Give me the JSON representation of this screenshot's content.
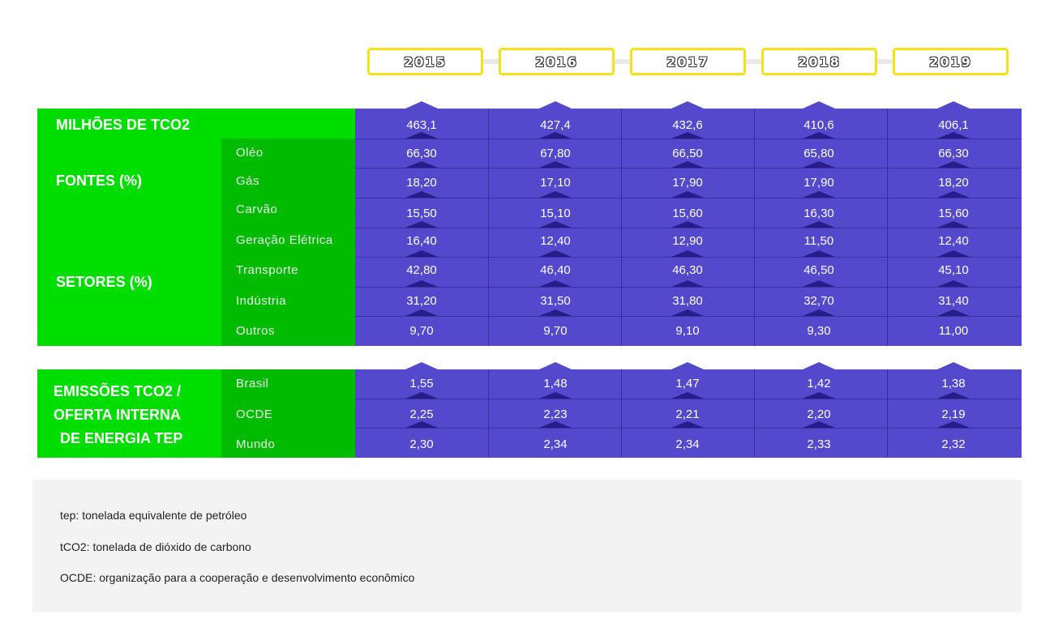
{
  "years": [
    "2015",
    "2016",
    "2017",
    "2018",
    "2019"
  ],
  "colors": {
    "label_green": "#00dd00",
    "sub_green": "#00bb00",
    "data_blue": "#5448cc",
    "year_border": "#f6e21a"
  },
  "table": {
    "milhoes_label": "MILHÕES DE TCO2",
    "milhoes_values": [
      "463,1",
      "427,4",
      "432,6",
      "410,6",
      "406,1"
    ],
    "fontes_label": "FONTES (%)",
    "setores_label": "SETORES (%)",
    "rows": [
      {
        "label": "Oléo",
        "values": [
          "66,30",
          "67,80",
          "66,50",
          "65,80",
          "66,30"
        ]
      },
      {
        "label": "Gás",
        "values": [
          "18,20",
          "17,10",
          "17,90",
          "17,90",
          "18,20"
        ]
      },
      {
        "label": "Carvão",
        "values": [
          "15,50",
          "15,10",
          "15,60",
          "16,30",
          "15,60"
        ]
      },
      {
        "label": "Geração Elétrica",
        "values": [
          "16,40",
          "12,40",
          "12,90",
          "11,50",
          "12,40"
        ]
      },
      {
        "label": "Transporte",
        "values": [
          "42,80",
          "46,40",
          "46,30",
          "46,50",
          "45,10"
        ]
      },
      {
        "label": "Indústria",
        "values": [
          "31,20",
          "31,50",
          "31,80",
          "32,70",
          "31,40"
        ]
      },
      {
        "label": "Outros",
        "values": [
          "9,70",
          "9,70",
          "9,10",
          "9,30",
          "11,00"
        ]
      }
    ],
    "emissoes_label_lines": [
      "EMISSÕES TCO2 /",
      "OFERTA INTERNA",
      "DE ENERGIA TEP"
    ],
    "emissoes_rows": [
      {
        "label": "Brasil",
        "values": [
          "1,55",
          "1,48",
          "1,47",
          "1,42",
          "1,38"
        ]
      },
      {
        "label": "OCDE",
        "values": [
          "2,25",
          "2,23",
          "2,21",
          "2,20",
          "2,19"
        ]
      },
      {
        "label": "Mundo",
        "values": [
          "2,30",
          "2,34",
          "2,34",
          "2,33",
          "2,32"
        ]
      }
    ]
  },
  "notes": [
    "tep: tonelada equivalente de petróleo",
    "tCO2: tonelada de dióxido de carbono",
    "OCDE: organização para a cooperação e desenvolvimento econômico"
  ],
  "chart_data": {
    "type": "table",
    "columns": [
      "2015",
      "2016",
      "2017",
      "2018",
      "2019"
    ],
    "rows": [
      {
        "group": "MILHÕES DE TCO2",
        "label": "",
        "values": [
          463.1,
          427.4,
          432.6,
          410.6,
          406.1
        ]
      },
      {
        "group": "FONTES (%)",
        "label": "Oléo",
        "values": [
          66.3,
          67.8,
          66.5,
          65.8,
          66.3
        ]
      },
      {
        "group": "FONTES (%)",
        "label": "Gás",
        "values": [
          18.2,
          17.1,
          17.9,
          17.9,
          18.2
        ]
      },
      {
        "group": "FONTES (%)",
        "label": "Carvão",
        "values": [
          15.5,
          15.1,
          15.6,
          16.3,
          15.6
        ]
      },
      {
        "group": "SETORES (%)",
        "label": "Geração Elétrica",
        "values": [
          16.4,
          12.4,
          12.9,
          11.5,
          12.4
        ]
      },
      {
        "group": "SETORES (%)",
        "label": "Transporte",
        "values": [
          42.8,
          46.4,
          46.3,
          46.5,
          45.1
        ]
      },
      {
        "group": "SETORES (%)",
        "label": "Indústria",
        "values": [
          31.2,
          31.5,
          31.8,
          32.7,
          31.4
        ]
      },
      {
        "group": "SETORES (%)",
        "label": "Outros",
        "values": [
          9.7,
          9.7,
          9.1,
          9.3,
          11.0
        ]
      },
      {
        "group": "EMISSÕES TCO2 / OFERTA INTERNA DE ENERGIA TEP",
        "label": "Brasil",
        "values": [
          1.55,
          1.48,
          1.47,
          1.42,
          1.38
        ]
      },
      {
        "group": "EMISSÕES TCO2 / OFERTA INTERNA DE ENERGIA TEP",
        "label": "OCDE",
        "values": [
          2.25,
          2.23,
          2.21,
          2.2,
          2.19
        ]
      },
      {
        "group": "EMISSÕES TCO2 / OFERTA INTERNA DE ENERGIA TEP",
        "label": "Mundo",
        "values": [
          2.3,
          2.34,
          2.34,
          2.33,
          2.32
        ]
      }
    ]
  }
}
